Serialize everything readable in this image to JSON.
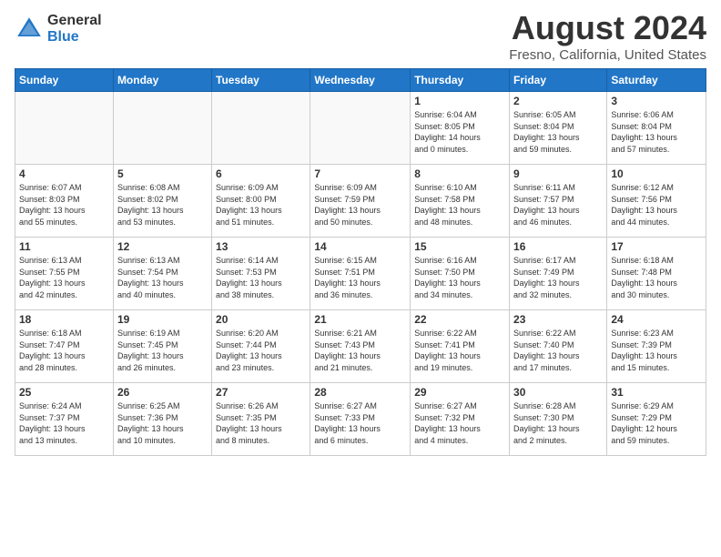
{
  "logo": {
    "general": "General",
    "blue": "Blue"
  },
  "title": "August 2024",
  "subtitle": "Fresno, California, United States",
  "days_of_week": [
    "Sunday",
    "Monday",
    "Tuesday",
    "Wednesday",
    "Thursday",
    "Friday",
    "Saturday"
  ],
  "weeks": [
    [
      {
        "day": "",
        "info": ""
      },
      {
        "day": "",
        "info": ""
      },
      {
        "day": "",
        "info": ""
      },
      {
        "day": "",
        "info": ""
      },
      {
        "day": "1",
        "info": "Sunrise: 6:04 AM\nSunset: 8:05 PM\nDaylight: 14 hours\nand 0 minutes."
      },
      {
        "day": "2",
        "info": "Sunrise: 6:05 AM\nSunset: 8:04 PM\nDaylight: 13 hours\nand 59 minutes."
      },
      {
        "day": "3",
        "info": "Sunrise: 6:06 AM\nSunset: 8:04 PM\nDaylight: 13 hours\nand 57 minutes."
      }
    ],
    [
      {
        "day": "4",
        "info": "Sunrise: 6:07 AM\nSunset: 8:03 PM\nDaylight: 13 hours\nand 55 minutes."
      },
      {
        "day": "5",
        "info": "Sunrise: 6:08 AM\nSunset: 8:02 PM\nDaylight: 13 hours\nand 53 minutes."
      },
      {
        "day": "6",
        "info": "Sunrise: 6:09 AM\nSunset: 8:00 PM\nDaylight: 13 hours\nand 51 minutes."
      },
      {
        "day": "7",
        "info": "Sunrise: 6:09 AM\nSunset: 7:59 PM\nDaylight: 13 hours\nand 50 minutes."
      },
      {
        "day": "8",
        "info": "Sunrise: 6:10 AM\nSunset: 7:58 PM\nDaylight: 13 hours\nand 48 minutes."
      },
      {
        "day": "9",
        "info": "Sunrise: 6:11 AM\nSunset: 7:57 PM\nDaylight: 13 hours\nand 46 minutes."
      },
      {
        "day": "10",
        "info": "Sunrise: 6:12 AM\nSunset: 7:56 PM\nDaylight: 13 hours\nand 44 minutes."
      }
    ],
    [
      {
        "day": "11",
        "info": "Sunrise: 6:13 AM\nSunset: 7:55 PM\nDaylight: 13 hours\nand 42 minutes."
      },
      {
        "day": "12",
        "info": "Sunrise: 6:13 AM\nSunset: 7:54 PM\nDaylight: 13 hours\nand 40 minutes."
      },
      {
        "day": "13",
        "info": "Sunrise: 6:14 AM\nSunset: 7:53 PM\nDaylight: 13 hours\nand 38 minutes."
      },
      {
        "day": "14",
        "info": "Sunrise: 6:15 AM\nSunset: 7:51 PM\nDaylight: 13 hours\nand 36 minutes."
      },
      {
        "day": "15",
        "info": "Sunrise: 6:16 AM\nSunset: 7:50 PM\nDaylight: 13 hours\nand 34 minutes."
      },
      {
        "day": "16",
        "info": "Sunrise: 6:17 AM\nSunset: 7:49 PM\nDaylight: 13 hours\nand 32 minutes."
      },
      {
        "day": "17",
        "info": "Sunrise: 6:18 AM\nSunset: 7:48 PM\nDaylight: 13 hours\nand 30 minutes."
      }
    ],
    [
      {
        "day": "18",
        "info": "Sunrise: 6:18 AM\nSunset: 7:47 PM\nDaylight: 13 hours\nand 28 minutes."
      },
      {
        "day": "19",
        "info": "Sunrise: 6:19 AM\nSunset: 7:45 PM\nDaylight: 13 hours\nand 26 minutes."
      },
      {
        "day": "20",
        "info": "Sunrise: 6:20 AM\nSunset: 7:44 PM\nDaylight: 13 hours\nand 23 minutes."
      },
      {
        "day": "21",
        "info": "Sunrise: 6:21 AM\nSunset: 7:43 PM\nDaylight: 13 hours\nand 21 minutes."
      },
      {
        "day": "22",
        "info": "Sunrise: 6:22 AM\nSunset: 7:41 PM\nDaylight: 13 hours\nand 19 minutes."
      },
      {
        "day": "23",
        "info": "Sunrise: 6:22 AM\nSunset: 7:40 PM\nDaylight: 13 hours\nand 17 minutes."
      },
      {
        "day": "24",
        "info": "Sunrise: 6:23 AM\nSunset: 7:39 PM\nDaylight: 13 hours\nand 15 minutes."
      }
    ],
    [
      {
        "day": "25",
        "info": "Sunrise: 6:24 AM\nSunset: 7:37 PM\nDaylight: 13 hours\nand 13 minutes."
      },
      {
        "day": "26",
        "info": "Sunrise: 6:25 AM\nSunset: 7:36 PM\nDaylight: 13 hours\nand 10 minutes."
      },
      {
        "day": "27",
        "info": "Sunrise: 6:26 AM\nSunset: 7:35 PM\nDaylight: 13 hours\nand 8 minutes."
      },
      {
        "day": "28",
        "info": "Sunrise: 6:27 AM\nSunset: 7:33 PM\nDaylight: 13 hours\nand 6 minutes."
      },
      {
        "day": "29",
        "info": "Sunrise: 6:27 AM\nSunset: 7:32 PM\nDaylight: 13 hours\nand 4 minutes."
      },
      {
        "day": "30",
        "info": "Sunrise: 6:28 AM\nSunset: 7:30 PM\nDaylight: 13 hours\nand 2 minutes."
      },
      {
        "day": "31",
        "info": "Sunrise: 6:29 AM\nSunset: 7:29 PM\nDaylight: 12 hours\nand 59 minutes."
      }
    ]
  ]
}
